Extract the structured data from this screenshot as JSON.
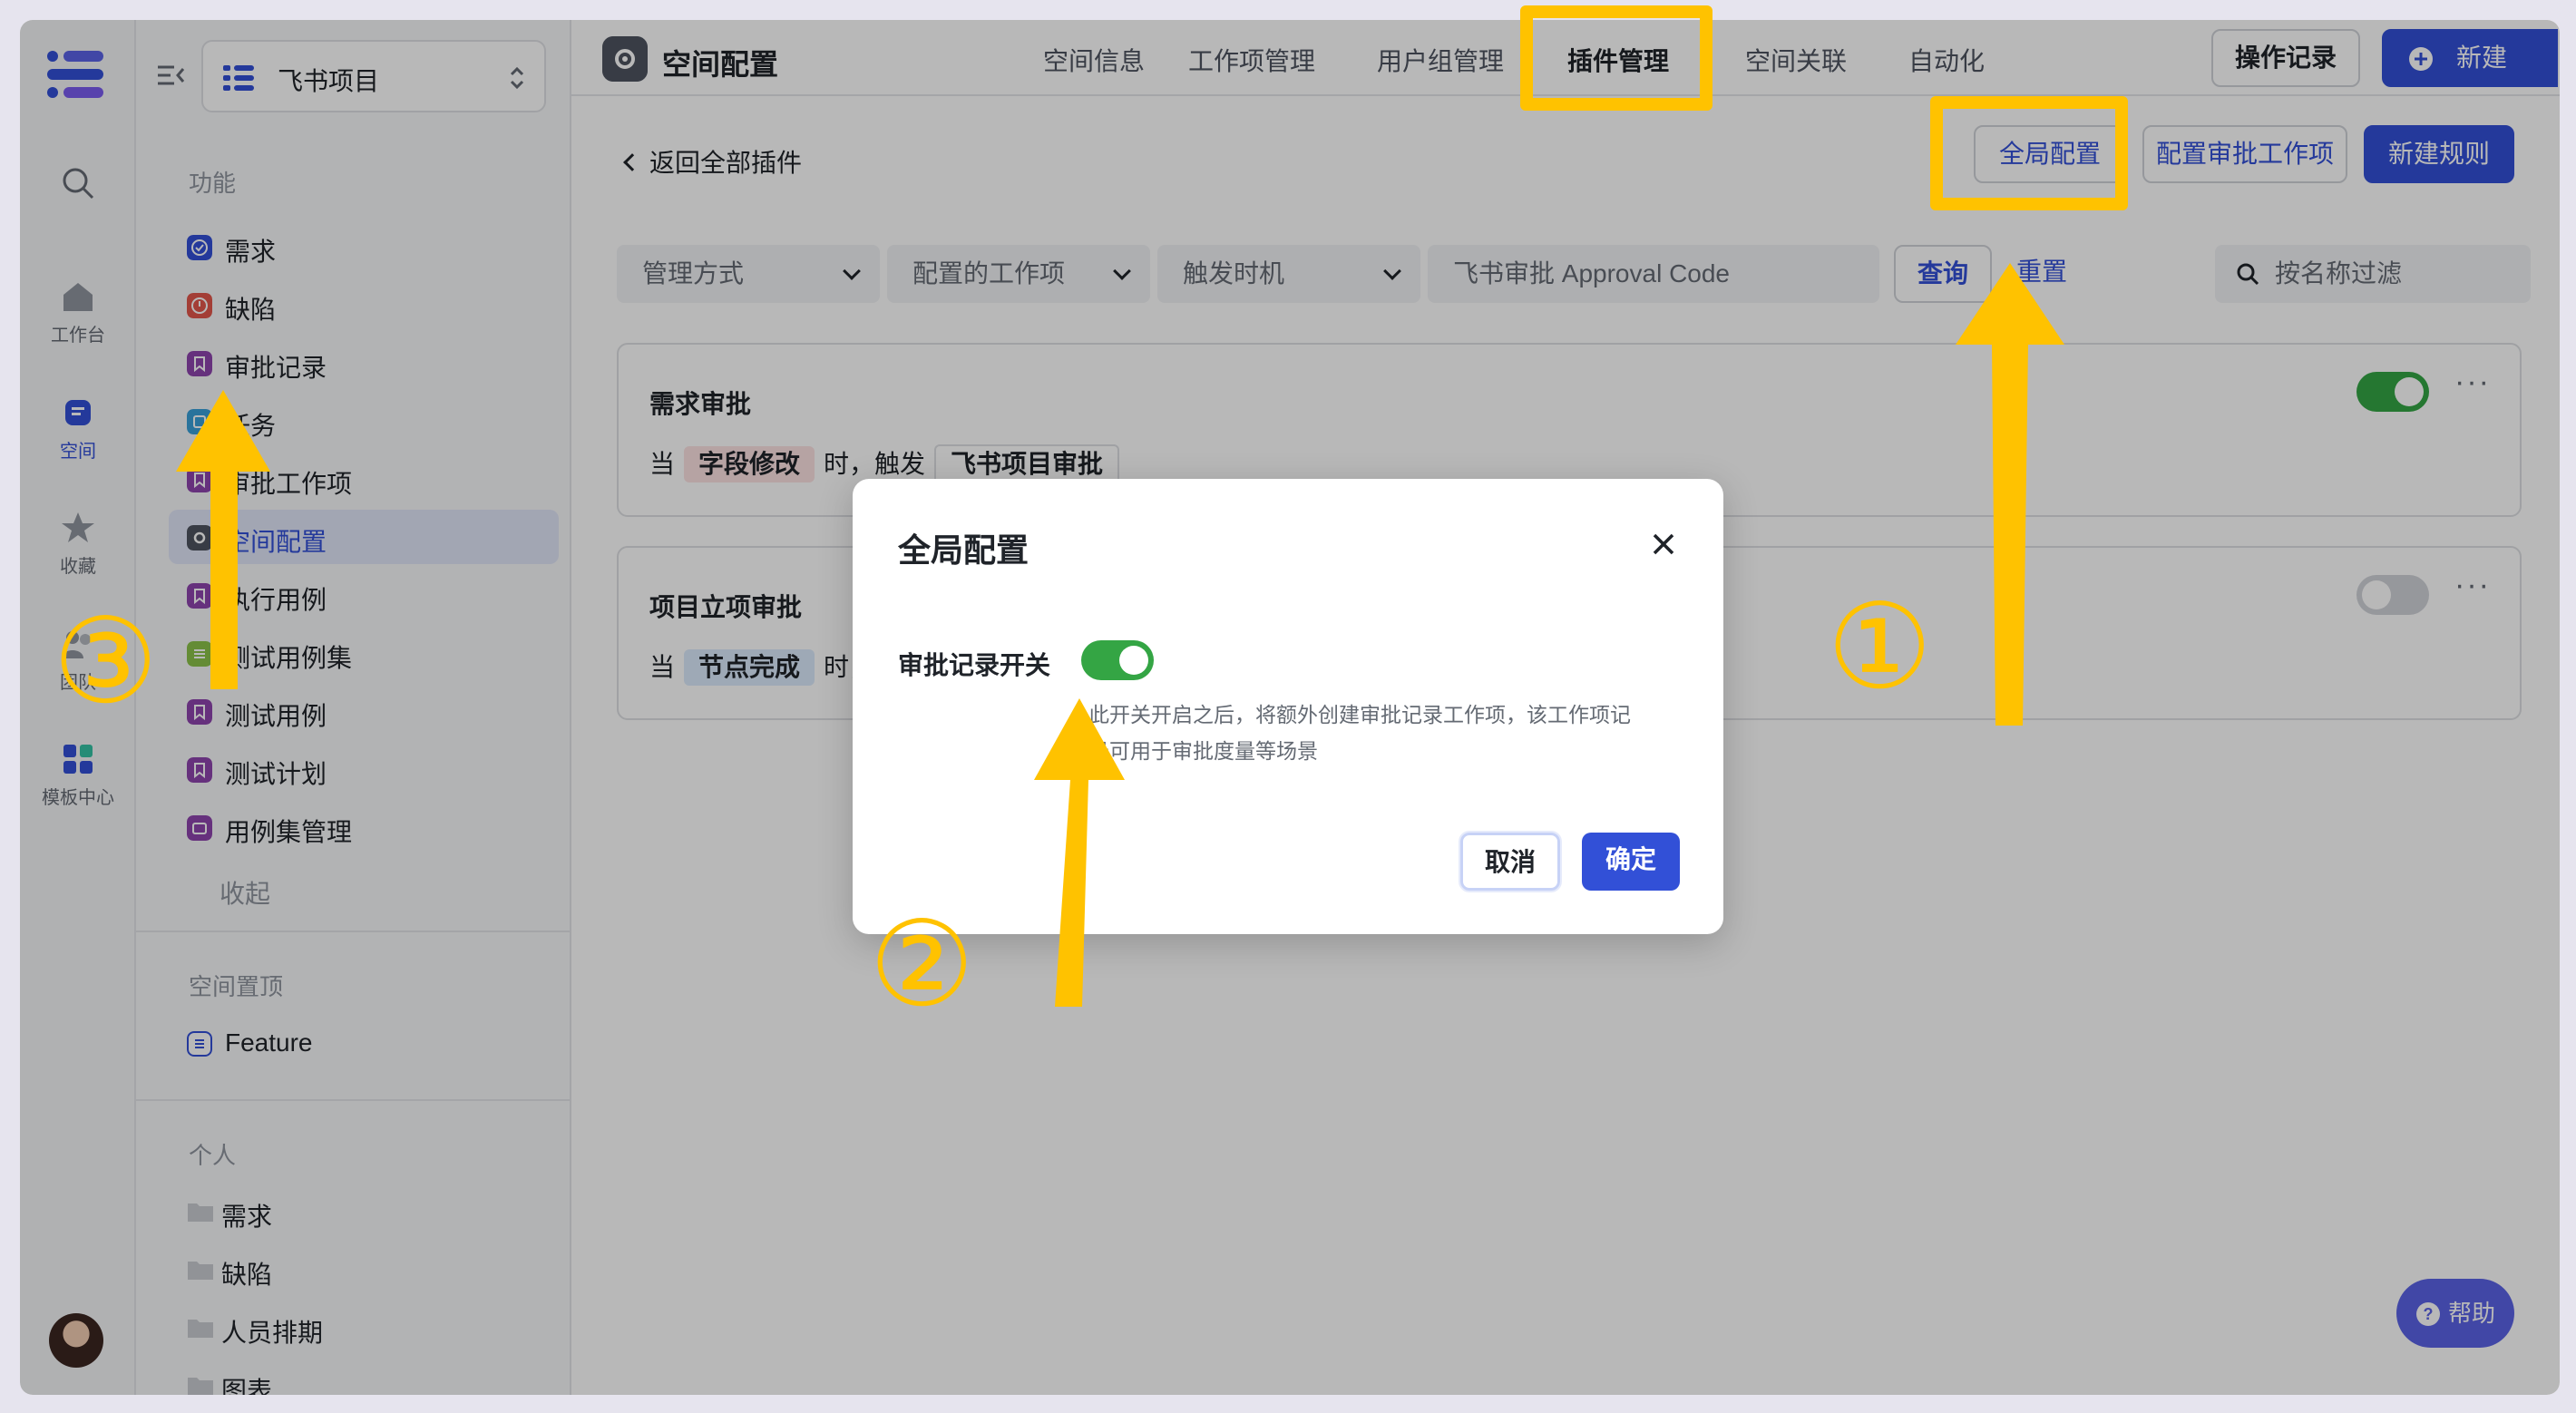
{
  "rail": {
    "items": [
      {
        "key": "search",
        "label": ""
      },
      {
        "key": "workbench",
        "label": "工作台"
      },
      {
        "key": "space",
        "label": "空间"
      },
      {
        "key": "favorites",
        "label": "收藏"
      },
      {
        "key": "team",
        "label": "团队"
      },
      {
        "key": "templates",
        "label": "模板中心"
      }
    ]
  },
  "sidebar": {
    "project_name": "飞书项目",
    "section_features": "功能",
    "items": [
      {
        "label": "需求",
        "color": "#3250d7"
      },
      {
        "label": "缺陷",
        "color": "#e2574c"
      },
      {
        "label": "审批记录",
        "color": "#8e44ad"
      },
      {
        "label": "任务",
        "color": "#3aa0d8"
      },
      {
        "label": "审批工作项",
        "color": "#8e44ad"
      },
      {
        "label": "空间配置",
        "color": "#4e5460"
      },
      {
        "label": "执行用例",
        "color": "#8e44ad"
      },
      {
        "label": "测试用例集",
        "color": "#8bc34a"
      },
      {
        "label": "测试用例",
        "color": "#8e44ad"
      },
      {
        "label": "测试计划",
        "color": "#8e44ad"
      },
      {
        "label": "用例集管理",
        "color": "#8e44ad"
      }
    ],
    "collapse_label": "收起",
    "section_pinned": "空间置顶",
    "pinned_item": "Feature",
    "section_personal": "个人",
    "personal_items": [
      "需求",
      "缺陷",
      "人员排期",
      "图表"
    ]
  },
  "topbar": {
    "page_title": "空间配置",
    "tabs": [
      "空间信息",
      "工作项管理",
      "用户组管理",
      "插件管理",
      "空间关联",
      "自动化"
    ],
    "active_tab": "插件管理",
    "ops_log": "操作记录",
    "new_label": "新建"
  },
  "plugin": {
    "back_label": "返回全部插件",
    "global_config": "全局配置",
    "config_approval_item": "配置审批工作项",
    "new_rule": "新建规则",
    "filters": {
      "manage_mode": "管理方式",
      "configured_item": "配置的工作项",
      "trigger_time": "触发时机",
      "approval_code_placeholder": "飞书审批 Approval Code",
      "query": "查询",
      "reset": "重置",
      "search_placeholder": "按名称过滤"
    },
    "rules": [
      {
        "title": "需求审批",
        "when": "当",
        "condition": "字段修改",
        "trigger_text": "时，触发",
        "action": "飞书项目审批",
        "enabled": true
      },
      {
        "title": "项目立项审批",
        "when": "当",
        "condition": "节点完成",
        "trigger_text": "时，触发",
        "action": "",
        "enabled": false
      }
    ]
  },
  "help": {
    "label": "帮助"
  },
  "modal": {
    "title": "全局配置",
    "switch_label": "审批记录开关",
    "switch_on": true,
    "description": "此开关开启之后，将额外创建审批记录工作项，该工作项记录可用于审批度量等场景",
    "cancel": "取消",
    "confirm": "确定"
  },
  "annotations": {
    "accent": "#ffc200",
    "step1": "①",
    "step2": "②",
    "step3": "③"
  },
  "colors": {
    "primary": "#3250d7",
    "toggle_on": "#34a544"
  }
}
